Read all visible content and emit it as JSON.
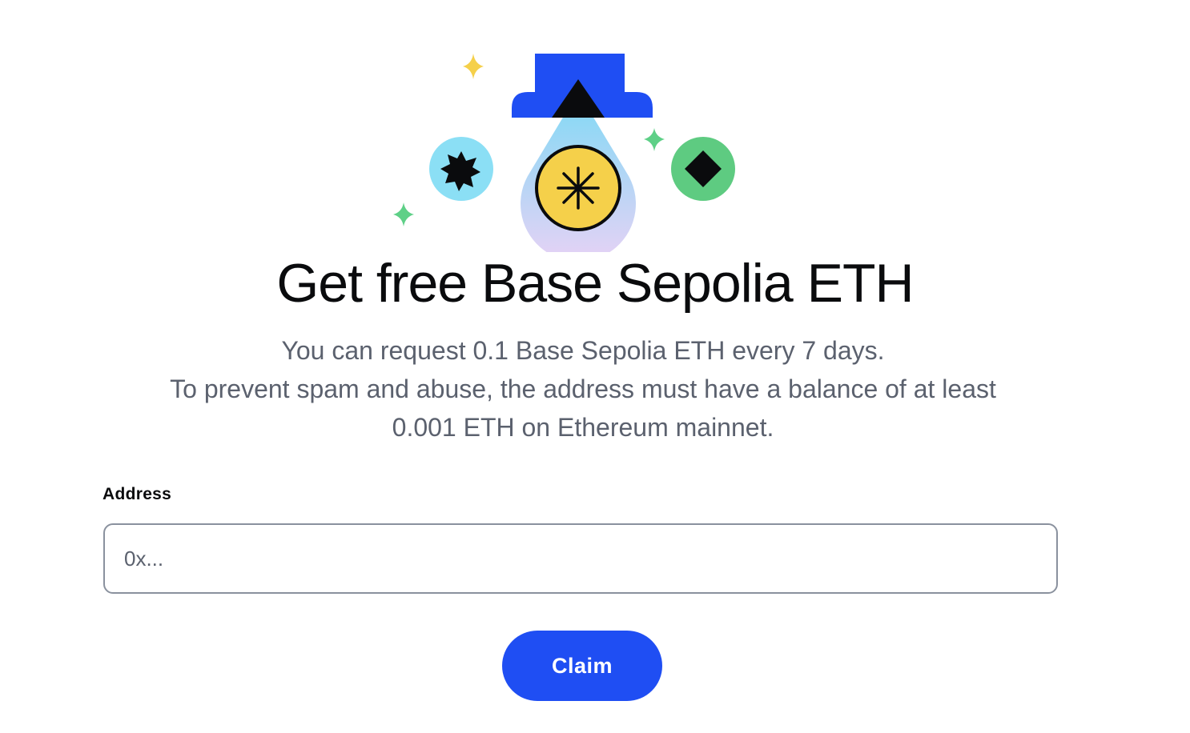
{
  "hero": {
    "icons": [
      "sparkle-icon",
      "faucet-icon",
      "star-coin-icon",
      "diamond-coin-icon",
      "eth-drop-icon"
    ],
    "colors": {
      "faucet": "#1f4ef3",
      "sparkle_yellow": "#f5d04a",
      "sparkle_green": "#5ed087",
      "coin_blue": "#8bdff5",
      "coin_green": "#5ecb81",
      "coin_yellow": "#f5d04a",
      "drop_top": "#7fd9f5",
      "drop_bottom": "#e6d2f5"
    }
  },
  "title": "Get free Base Sepolia ETH",
  "description": {
    "line1": "You can request 0.1 Base Sepolia ETH every 7 days.",
    "line2": "To prevent spam and abuse, the address must have a balance of at least",
    "line3": "0.001 ETH on Ethereum mainnet."
  },
  "form": {
    "address_label": "Address",
    "address_placeholder": "0x...",
    "address_value": "",
    "claim_label": "Claim"
  },
  "colors": {
    "accent": "#1f4ef3",
    "text_primary": "#0a0b0d",
    "text_secondary": "#5b616e",
    "input_border": "#8a919e"
  }
}
